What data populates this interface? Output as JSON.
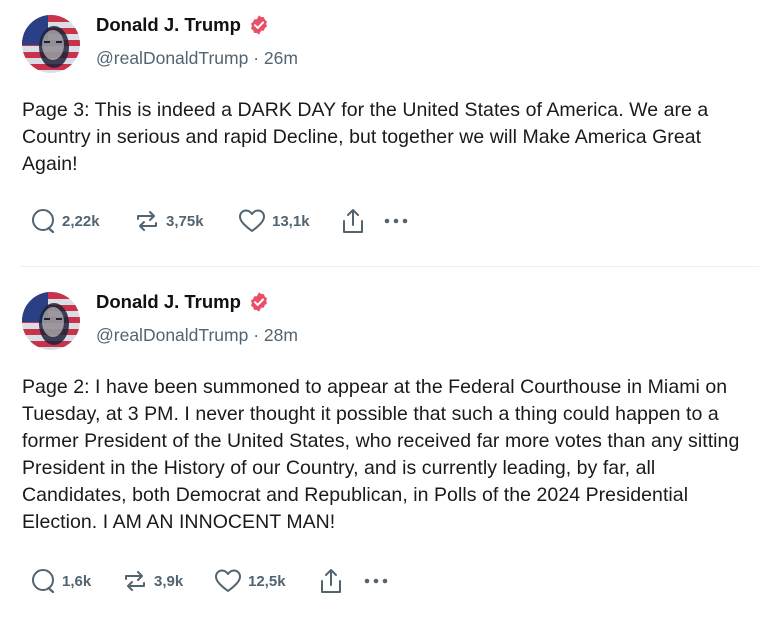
{
  "posts": [
    {
      "author": {
        "name": "Donald J. Trump",
        "handle": "@realDonaldTrump",
        "time": "26m"
      },
      "text": "Page 3: This is indeed a DARK DAY for the United States of America. We are a Country in serious and rapid Decline, but together we will Make America Great Again!",
      "stats": {
        "replies": "2,22k",
        "reposts": "3,75k",
        "likes": "13,1k"
      }
    },
    {
      "author": {
        "name": "Donald J. Trump",
        "handle": "@realDonaldTrump",
        "time": "28m"
      },
      "text": "Page 2: I have been summoned to appear at the Federal Courthouse in Miami on Tuesday, at 3 PM. I never thought it possible that such a thing could happen to a former President of the United States, who received far more votes than any sitting President in the History of our Country, and is currently leading, by far, all Candidates, both Democrat and Republican, in Polls of the 2024 Presidential Election. I AM AN INNOCENT MAN!",
      "stats": {
        "replies": "1,6k",
        "reposts": "3,9k",
        "likes": "12,5k"
      }
    }
  ],
  "colors": {
    "verified": "#e8506a",
    "muted": "#536471",
    "text": "#1a1a1a"
  },
  "icons": [
    "verified-badge-icon",
    "reply-icon",
    "repost-icon",
    "like-icon",
    "share-icon",
    "more-icon"
  ],
  "separator": " · "
}
